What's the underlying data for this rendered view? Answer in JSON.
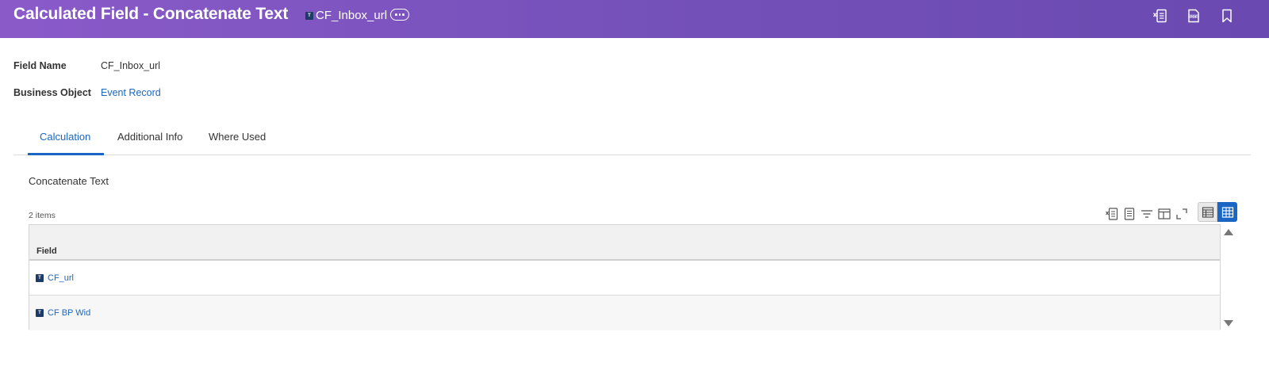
{
  "header": {
    "title": "Calculated Field - Concatenate Text",
    "chip_label": "CF_Inbox_url",
    "chip_badge": "T",
    "actions": [
      "export-excel-icon",
      "export-pdf-icon",
      "bookmark-icon"
    ]
  },
  "fields": {
    "field_name_label": "Field Name",
    "field_name_value": "CF_Inbox_url",
    "business_object_label": "Business Object",
    "business_object_value": "Event Record"
  },
  "tabs": [
    {
      "label": "Calculation",
      "active": true
    },
    {
      "label": "Additional Info",
      "active": false
    },
    {
      "label": "Where Used",
      "active": false
    }
  ],
  "section": {
    "title": "Concatenate Text",
    "item_count": "2 items"
  },
  "table": {
    "columns": [
      "Field"
    ],
    "rows": [
      {
        "badge": "T",
        "field": "CF_url"
      },
      {
        "badge": "T",
        "field": "CF BP Wid"
      }
    ]
  },
  "colors": {
    "header_gradient_start": "#8a5ac9",
    "header_gradient_end": "#6a4ab0",
    "link": "#1a66c2",
    "badge": "#1e3a66"
  }
}
